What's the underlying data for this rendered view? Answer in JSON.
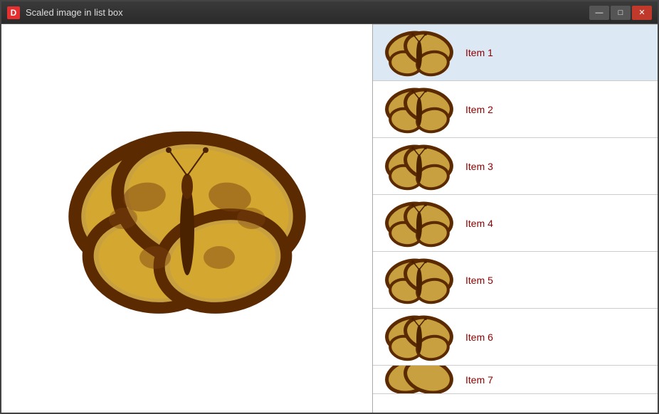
{
  "window": {
    "title": "Scaled image in list box",
    "icon_label": "D",
    "buttons": {
      "minimize": "—",
      "maximize": "□",
      "close": "✕"
    }
  },
  "list": {
    "items": [
      {
        "label": "Item 1",
        "id": 1
      },
      {
        "label": "Item 2",
        "id": 2
      },
      {
        "label": "Item 3",
        "id": 3
      },
      {
        "label": "Item 4",
        "id": 4
      },
      {
        "label": "Item 5",
        "id": 5
      },
      {
        "label": "Item 6",
        "id": 6
      },
      {
        "label": "Item 7",
        "id": 7
      }
    ]
  },
  "colors": {
    "text_dark_red": "#8b0000",
    "selected_bg": "#dde8f5",
    "accent": "#e63030"
  }
}
